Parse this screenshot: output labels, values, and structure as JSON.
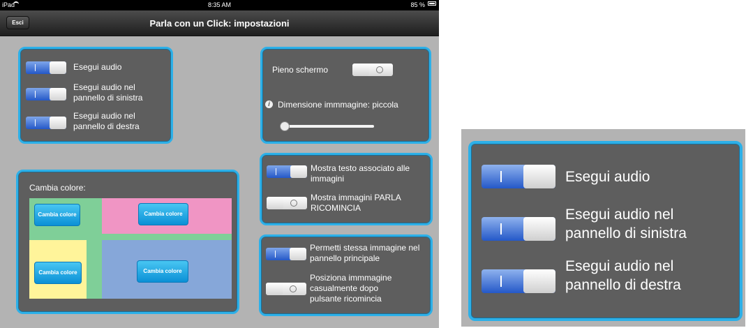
{
  "statusbar": {
    "device": "iPad",
    "time": "8:35 AM",
    "battery": "85 %"
  },
  "navbar": {
    "title": "Parla con un Click: impostazioni",
    "back_label": "Esci"
  },
  "audio_panel": {
    "items": [
      {
        "label": "Esegui audio",
        "on": true
      },
      {
        "label": "Esegui audio nel pannello di sinistra",
        "on": true
      },
      {
        "label": "Esegui audio nel pannello di destra",
        "on": true
      }
    ]
  },
  "screen_panel": {
    "fullscreen_label": "Pieno schermo",
    "fullscreen_on": false,
    "size_label": "Dimensione immmagine: piccola",
    "size_slider_value": 0.0
  },
  "color_panel": {
    "title": "Cambia colore:",
    "button_label": "Cambia colore",
    "colors": {
      "top_left": "#7fcf98",
      "top_right": "#f095c4",
      "bottom_left": "#fff49a",
      "bottom_right": "#86a7d9",
      "separator": "#7fcf98"
    }
  },
  "text_panel": {
    "items": [
      {
        "label": "Mostra testo associato alle immagini",
        "on": true
      },
      {
        "label": "Mostra immagini PARLA RICOMINCIA",
        "on": false
      }
    ]
  },
  "image_panel": {
    "items": [
      {
        "label": "Permetti stessa immagine nel pannello principale",
        "on": true
      },
      {
        "label": "Posiziona immmagine casualmente dopo pulsante ricomincia",
        "on": false
      }
    ]
  },
  "zoom_panel": {
    "items": [
      {
        "label": "Esegui audio"
      },
      {
        "label": "Esegui audio nel pannello di sinistra"
      },
      {
        "label": "Esegui audio nel pannello di destra"
      }
    ]
  },
  "colors": {
    "accent_border": "#2db0e8",
    "panel_bg": "#5e5e5e",
    "switch_on": "#2458c8",
    "button": "#0b90d6"
  }
}
